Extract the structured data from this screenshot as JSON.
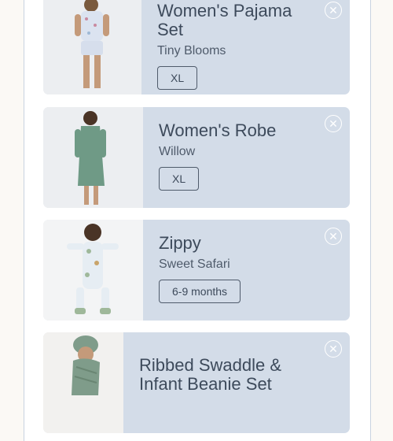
{
  "cart": {
    "items": [
      {
        "title": "Women's Pajama Set",
        "variant": "Tiny Blooms",
        "size": "XL",
        "remove_icon": "close-icon"
      },
      {
        "title": "Women's Robe",
        "variant": "Willow",
        "size": "XL",
        "remove_icon": "close-icon"
      },
      {
        "title": "Zippy",
        "variant": "Sweet Safari",
        "size": "6-9 months",
        "remove_icon": "close-icon"
      },
      {
        "title": "Ribbed Swaddle & Infant Beanie Set",
        "variant": "",
        "size": "",
        "remove_icon": "close-icon"
      }
    ]
  },
  "colors": {
    "page_bg": "#fbf9f5",
    "card_bg": "#d3dce8",
    "text": "#3d4a5b",
    "close_icon": "#ffffff"
  }
}
